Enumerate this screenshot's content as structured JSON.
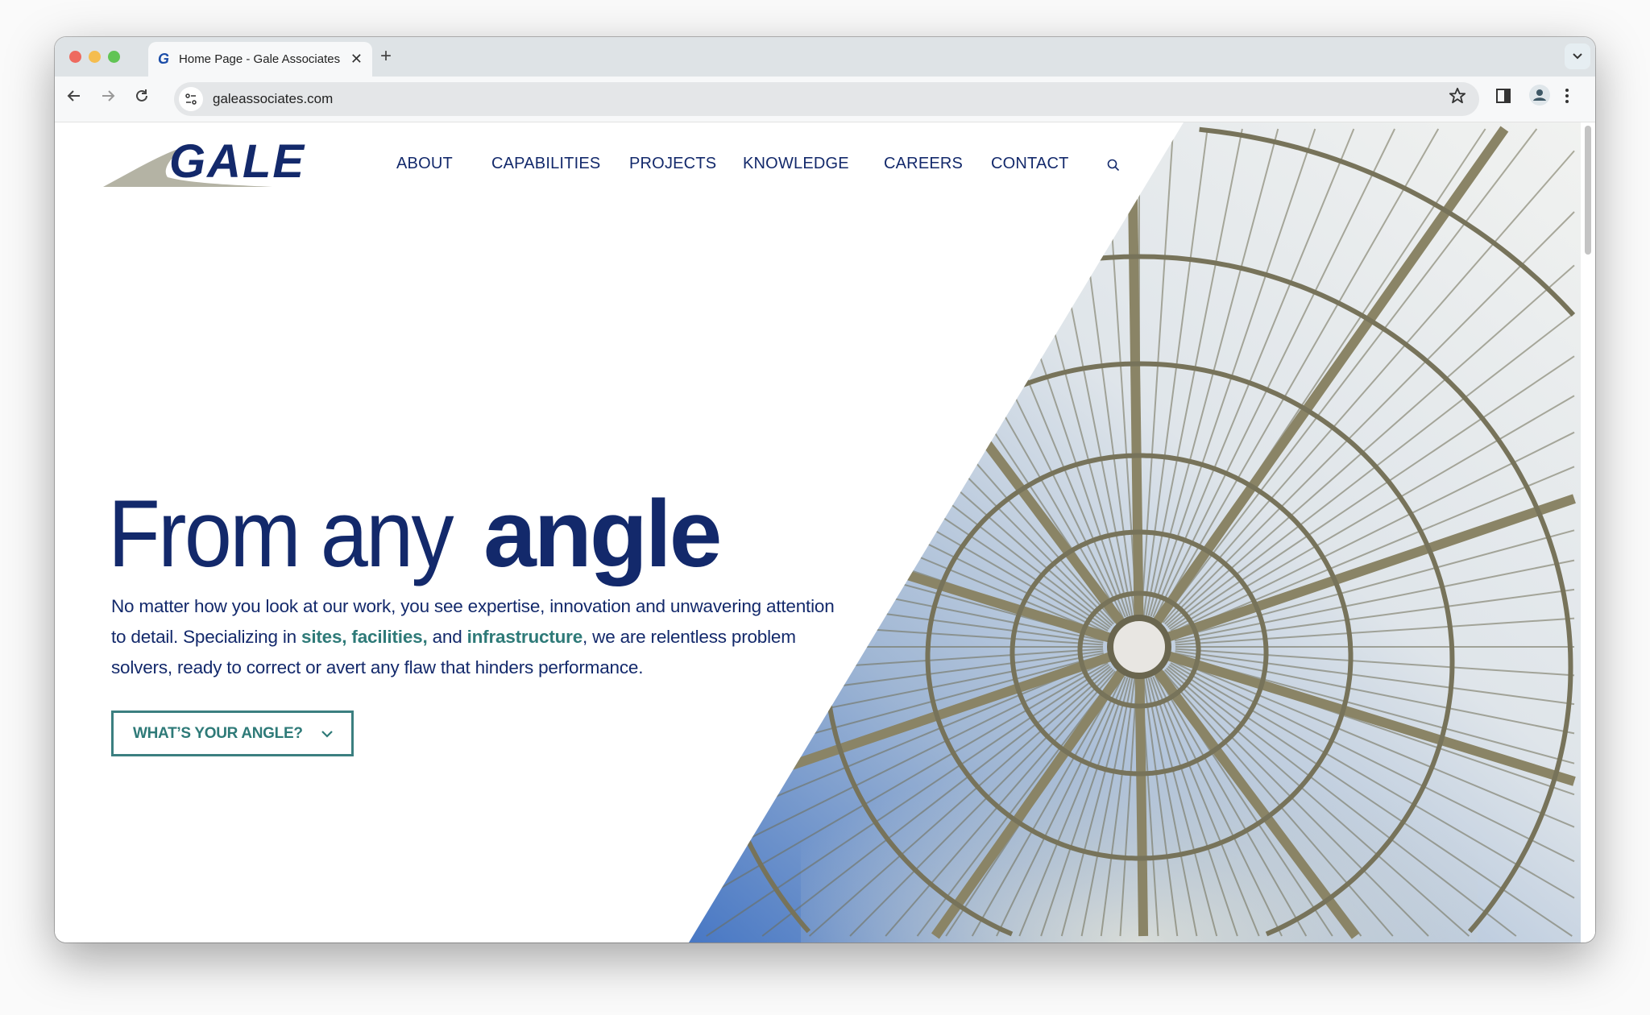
{
  "browser": {
    "tab_title": "Home Page - Gale Associates",
    "tab_favicon": "G",
    "close_glyph": "✕",
    "new_tab_glyph": "+",
    "url": "galeassociates.com",
    "colors": {
      "close": "#ee6a5f",
      "minimize": "#f5bd4f",
      "maximize": "#61c454"
    }
  },
  "site": {
    "logo_text": "GALE",
    "nav": [
      {
        "label": "ABOUT"
      },
      {
        "label": "CAPABILITIES"
      },
      {
        "label": "PROJECTS"
      },
      {
        "label": "KNOWLEDGE"
      },
      {
        "label": "CAREERS"
      },
      {
        "label": "CONTACT"
      }
    ],
    "hero": {
      "headline_light": "From any",
      "headline_bold": "angle",
      "para_1": "No matter how you look at our work, you see expertise, innovation and unwavering attention to detail. Specializing in ",
      "link_sites": "sites,",
      "link_facilities": "facilities,",
      "para_and": " and ",
      "link_infrastructure": "infrastructure",
      "para_2": ", we are relentless problem solvers, ready to correct or avert any flaw that hinders performance.",
      "cta_label": "WHAT’S YOUR ANGLE?"
    },
    "colors": {
      "navy": "#13296b",
      "teal": "#2e7a78",
      "logo_swoosh": "#b4b3a4"
    }
  }
}
